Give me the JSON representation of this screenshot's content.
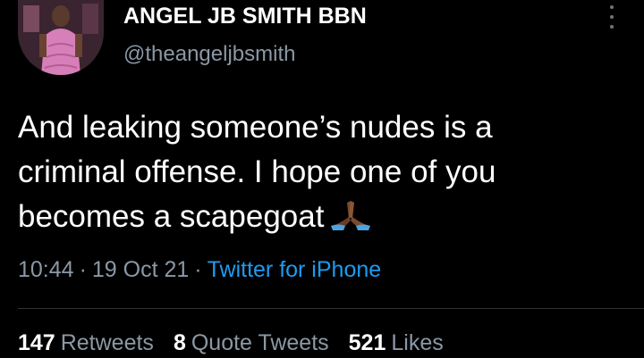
{
  "user": {
    "display_name": "ANGEL JB SMITH BBN",
    "handle": "@theangeljbsmith"
  },
  "tweet": {
    "lines": [
      "And leaking someone’s nudes is a",
      "criminal offense. I hope one of you",
      "becomes a scapegoat"
    ],
    "emoji": "folded-hands-icon"
  },
  "meta": {
    "time": "10:44",
    "date": "19 Oct 21",
    "source": "Twitter for iPhone",
    "separator": "·"
  },
  "stats": {
    "retweets_count": "147",
    "retweets_label": "Retweets",
    "quotes_count": "8",
    "quotes_label": "Quote Tweets",
    "likes_count": "521",
    "likes_label": "Likes"
  },
  "colors": {
    "background": "#000000",
    "text": "#ffffff",
    "secondary": "#8b98a5",
    "link": "#1d9bf0"
  }
}
